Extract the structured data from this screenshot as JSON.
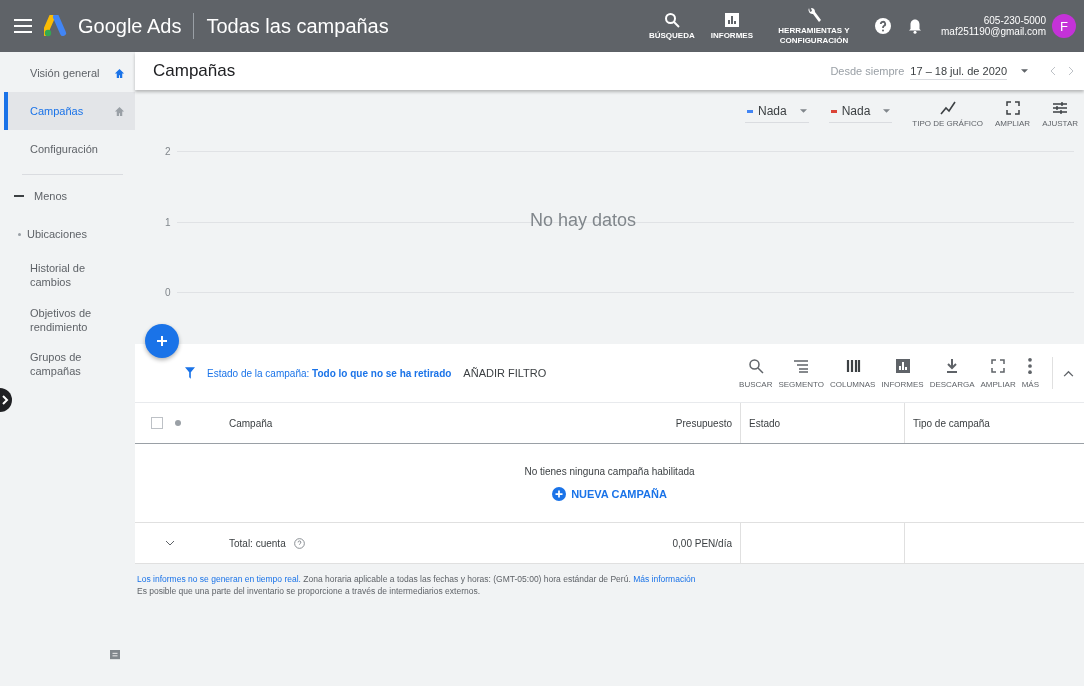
{
  "top_bar": {
    "product": "Google Ads",
    "page_title": "Todas las campañas",
    "actions": [
      {
        "kind": "search",
        "label": "BÚSQUEDA"
      },
      {
        "kind": "reports",
        "label": "INFORMES"
      },
      {
        "kind": "tools",
        "label": "HERRAMIENTAS Y CONFIGURACIÓN"
      }
    ],
    "account": {
      "phone": "605-230-5000",
      "email": "maf251190@gmail.com",
      "initial": "F"
    }
  },
  "sidebar": {
    "items": [
      {
        "label": "Visión general",
        "selected": false,
        "kind": "home"
      },
      {
        "label": "Campañas",
        "selected": true,
        "kind": "home"
      },
      {
        "label": "Configuración",
        "selected": false,
        "kind": "plain"
      },
      {
        "label": "Menos",
        "selected": false,
        "kind": "toggle"
      },
      {
        "label": "Ubicaciones",
        "selected": false,
        "kind": "bullet"
      },
      {
        "label": "Historial de cambios",
        "selected": false,
        "kind": "plain"
      },
      {
        "label": "Objetivos de rendimiento",
        "selected": false,
        "kind": "plain"
      },
      {
        "label": "Grupos de campañas",
        "selected": false,
        "kind": "plain"
      }
    ]
  },
  "header": {
    "title": "Campañas",
    "date_label": "Desde siempre",
    "date_range": "17 – 18 jul. de 2020"
  },
  "chart": {
    "metrics": [
      {
        "label": "Nada",
        "color": "#4285f4"
      },
      {
        "label": "Nada",
        "color": "#db4437"
      }
    ],
    "tools": [
      {
        "kind": "chart-type",
        "label": "TIPO DE GRÁFICO"
      },
      {
        "kind": "expand",
        "label": "AMPLIAR"
      },
      {
        "kind": "adjust",
        "label": "AJUSTAR"
      }
    ],
    "y_labels": [
      "2",
      "1",
      "0"
    ],
    "empty_message": "No hay datos"
  },
  "filter": {
    "prefix": "Estado de la campaña:",
    "value": "Todo lo que no se ha retirado",
    "add_label": "AÑADIR FILTRO"
  },
  "table_tools": [
    {
      "kind": "search",
      "label": "BUSCAR"
    },
    {
      "kind": "segment",
      "label": "SEGMENTO"
    },
    {
      "kind": "columns",
      "label": "COLUMNAS"
    },
    {
      "kind": "reports",
      "label": "INFORMES"
    },
    {
      "kind": "download",
      "label": "DESCARGA"
    },
    {
      "kind": "expand",
      "label": "AMPLIAR"
    },
    {
      "kind": "more",
      "label": "MÁS"
    }
  ],
  "table": {
    "select_all_checked": false,
    "columns": [
      "Campaña",
      "Presupuesto",
      "Estado",
      "Tipo de campaña"
    ],
    "empty_message": "No tienes ninguna campaña habilitada",
    "new_label": "NUEVA CAMPAÑA",
    "total": {
      "label": "Total: cuenta",
      "budget": "0,00 PEN/día"
    }
  },
  "footer": {
    "link": "Los informes no se generan en tiempo real.",
    "text": "Zona horaria aplicable a todas las fechas y horas: (GMT-05:00) hora estándar de Perú.",
    "more": "Más información",
    "note": "Es posible que una parte del inventario se proporcione a través de intermediarios externos."
  }
}
